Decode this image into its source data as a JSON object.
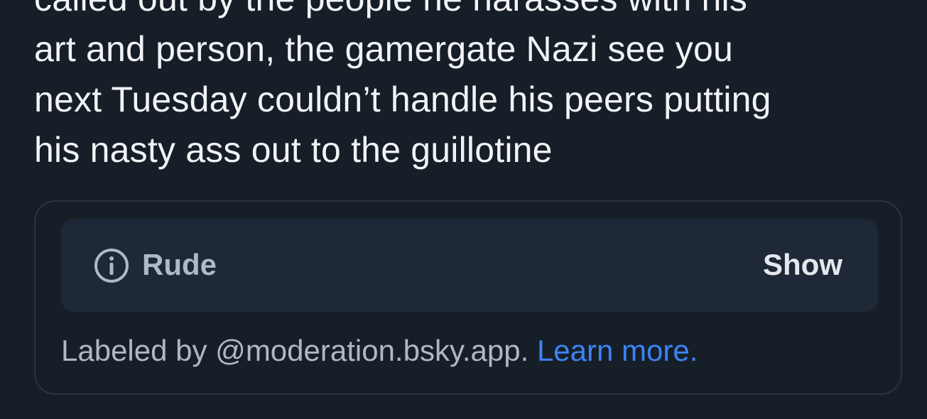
{
  "post": {
    "lines": [
      "called out by the people he harasses with his",
      "art and person, the gamergate Nazi see you",
      "next Tuesday couldn’t handle his peers putting",
      "his nasty ass out to the guillotine"
    ]
  },
  "moderation": {
    "icon": "info-circle-icon",
    "label": "Rude",
    "show_label": "Show",
    "labeled_by": "Labeled by @moderation.bsky.app.",
    "learn_more": "Learn more."
  },
  "colors": {
    "background": "#161e27",
    "card_fill": "#1e2836",
    "card_border": "#2b3542",
    "muted_text": "#aeb8c6",
    "link": "#3c83f6"
  }
}
